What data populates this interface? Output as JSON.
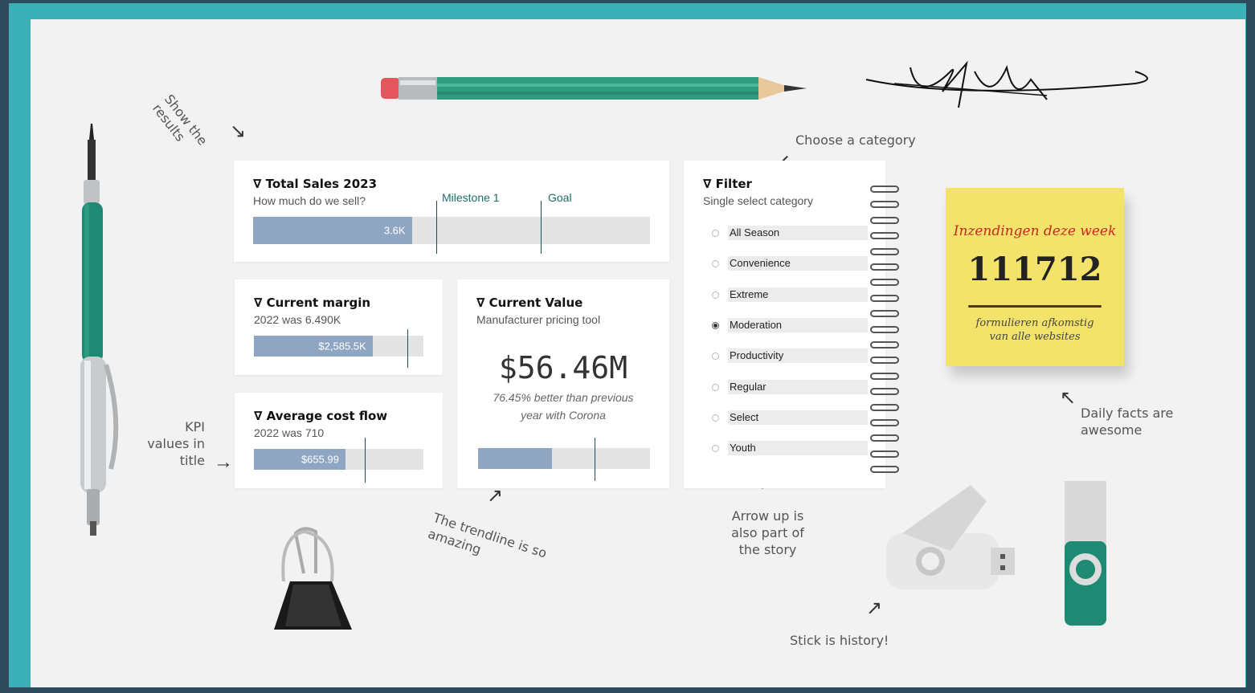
{
  "colors": {
    "frame": "#3bb1b7",
    "background": "#f2f2f2",
    "bar_fill": "#8fa6c2",
    "bar_track": "#e4e4e4",
    "accent_green": "#1e8a73",
    "sticky_note": "#f3e36b"
  },
  "annotations": {
    "show_results": "Show the results",
    "choose_category": "Choose a category",
    "kpi_values": "KPI values in title",
    "trendline": "The trendline is so amazing",
    "arrow_up": "Arrow up is also part of the story",
    "stick_history": "Stick is history!",
    "daily_facts": "Daily facts are awesome"
  },
  "total_sales": {
    "title": "∇ Total Sales 2023",
    "subtitle": "How much do we sell?",
    "value_label": "3.6K",
    "fill_fraction": 0.4,
    "milestone_label": "Milestone 1",
    "goal_label": "Goal"
  },
  "current_margin": {
    "title": "∇ Current margin",
    "subtitle": "2022 was 6.490K",
    "value_label": "$2,585.5K",
    "fill_fraction": 0.7
  },
  "avg_cost_flow": {
    "title": "∇ Average cost flow",
    "subtitle": "2022 was 710",
    "value_label": "$655.99",
    "fill_fraction": 0.54
  },
  "current_value": {
    "title": "∇ Current Value",
    "subtitle": "Manufacturer pricing tool",
    "big_value": "$56.46M",
    "comparison": "76.45% better than previous year with Corona",
    "fill_fraction": 0.43
  },
  "filter": {
    "title": "∇ Filter",
    "subtitle": "Single select category",
    "options": [
      {
        "label": "All Season",
        "selected": false
      },
      {
        "label": "Convenience",
        "selected": false
      },
      {
        "label": "Extreme",
        "selected": false
      },
      {
        "label": "Moderation",
        "selected": true
      },
      {
        "label": "Productivity",
        "selected": false
      },
      {
        "label": "Regular",
        "selected": false
      },
      {
        "label": "Select",
        "selected": false
      },
      {
        "label": "Youth",
        "selected": false
      }
    ]
  },
  "sticky_note": {
    "heading": "Inzendingen deze week",
    "value": "111712",
    "footer": "formulieren afkomstig van alle websites"
  },
  "icons": [
    "pen-icon",
    "pencil-icon",
    "signature-icon",
    "binder-clip-icon",
    "usb-stick-icon",
    "usb-stick-green-icon",
    "spiral-binding-icon",
    "arrow-icon"
  ]
}
